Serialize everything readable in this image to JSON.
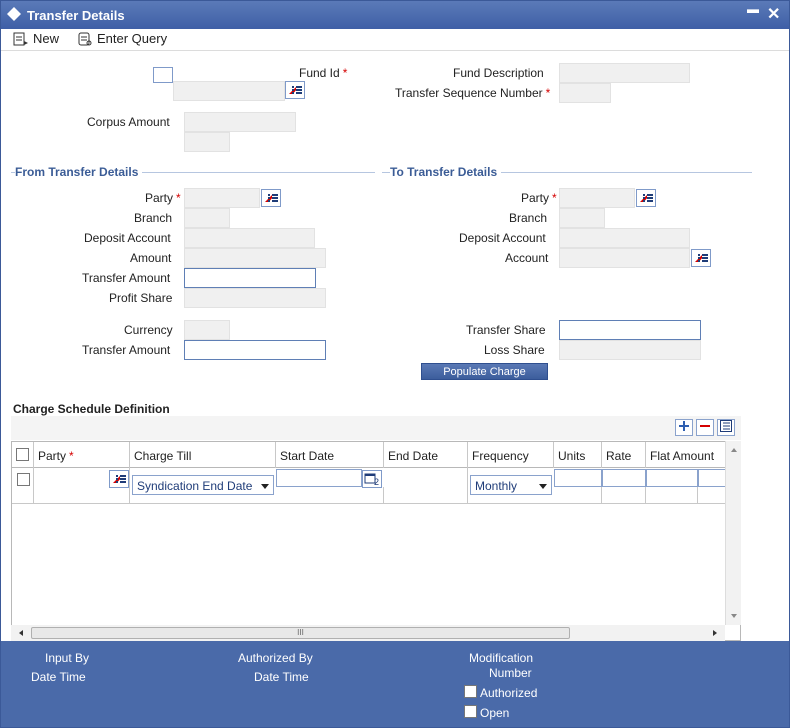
{
  "window": {
    "title": "Transfer Details",
    "minimize": "▬",
    "close": "✕"
  },
  "toolbar": {
    "new_label": "New",
    "enter_query_label": "Enter Query"
  },
  "header": {
    "fund_id_label": "Fund Id",
    "fund_description_label": "Fund Description",
    "transfer_sequence_label": "Transfer Sequence Number",
    "corpus_amount_label": "Corpus Amount"
  },
  "from_section": {
    "title": "From Transfer Details",
    "party_label": "Party",
    "branch_label": "Branch",
    "deposit_account_label": "Deposit Account",
    "amount_label": "Amount",
    "transfer_amount_label": "Transfer Amount",
    "profit_share_label": "Profit Share",
    "currency_label": "Currency",
    "transfer_amount2_label": "Transfer Amount"
  },
  "to_section": {
    "title": "To Transfer Details",
    "party_label": "Party",
    "branch_label": "Branch",
    "deposit_account_label": "Deposit Account",
    "account_label": "Account",
    "transfer_share_label": "Transfer Share",
    "loss_share_label": "Loss Share"
  },
  "populate_button": "Populate Charge",
  "charge_grid": {
    "title": "Charge Schedule Definition",
    "columns": [
      "Party",
      "Charge Till",
      "Start Date",
      "End Date",
      "Frequency",
      "Units",
      "Rate",
      "Flat Amount"
    ],
    "row": {
      "charge_till": "Syndication End Date",
      "frequency": "Monthly"
    },
    "scroll_grip": "III"
  },
  "footer": {
    "input_by": "Input By",
    "date_time_1": "Date Time",
    "authorized_by": "Authorized By",
    "date_time_2": "Date Time",
    "modification": "Modification",
    "number": "Number",
    "authorized": "Authorized",
    "open": "Open"
  }
}
